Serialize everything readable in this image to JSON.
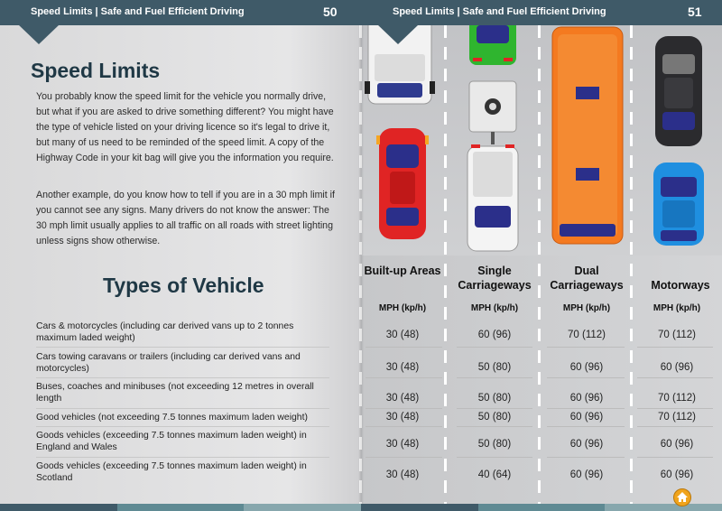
{
  "header": {
    "left_title": "Speed Limits | Safe and Fuel Efficient Driving",
    "left_page": "50",
    "right_title": "Speed Limits | Safe and Fuel Efficient Driving",
    "right_page": "51"
  },
  "left": {
    "title": "Speed Limits",
    "para1": "You probably know the speed limit for the vehicle you normally drive, but what if you are asked to drive something different? You might have the type of vehicle listed on your driving licence so it's legal to drive it, but many of us need to be reminded of the speed limit. A copy of the Highway Code in your kit bag will give you the information you require.",
    "para2": "Another example, do you know how to tell if you are in a 30 mph limit if you cannot see any signs. Many drivers do not know the answer: The 30 mph limit usually applies to all traffic on all roads with street lighting unless signs show otherwise.",
    "table_title": "Types of Vehicle"
  },
  "table": {
    "columns": [
      {
        "heading": "Built-up Areas",
        "unit": "MPH (kp/h)"
      },
      {
        "heading": "Single Carriageways",
        "unit": "MPH (kp/h)"
      },
      {
        "heading": "Dual Carriageways",
        "unit": "MPH (kp/h)"
      },
      {
        "heading": "Motorways",
        "unit": "MPH (kp/h)"
      }
    ],
    "rows": [
      {
        "label": "Cars & motorcycles (including car derived vans up to 2 tonnes maximum laded weight)",
        "values": [
          "30 (48)",
          "60 (96)",
          "70 (112)",
          "70 (112)"
        ]
      },
      {
        "label": "Cars towing caravans or trailers (including car derived vans and motorcycles)",
        "values": [
          "30 (48)",
          "50 (80)",
          "60 (96)",
          "60 (96)"
        ]
      },
      {
        "label": "Buses, coaches and minibuses (not exceeding 12 metres in overall length",
        "values": [
          "30 (48)",
          "50 (80)",
          "60 (96)",
          "70 (112)"
        ]
      },
      {
        "label": "Good vehicles (not exceeding 7.5 tonnes maximum laden weight)",
        "values": [
          "30 (48)",
          "50 (80)",
          "60 (96)",
          "70 (112)"
        ]
      },
      {
        "label": "Goods vehicles (exceeding 7.5 tonnes maximum laden weight) in England and Wales",
        "values": [
          "30 (48)",
          "50 (80)",
          "60 (96)",
          "60 (96)"
        ]
      },
      {
        "label": "Goods vehicles (exceeding 7.5 tonnes maximum laden weight) in Scotland",
        "values": [
          "30 (48)",
          "40 (64)",
          "60 (96)",
          "60 (96)"
        ]
      }
    ]
  },
  "icons": {
    "home": "home-icon"
  },
  "colors": {
    "header": "#3f5a68",
    "heading": "#1f3845",
    "home_button": "#f0a41c"
  }
}
